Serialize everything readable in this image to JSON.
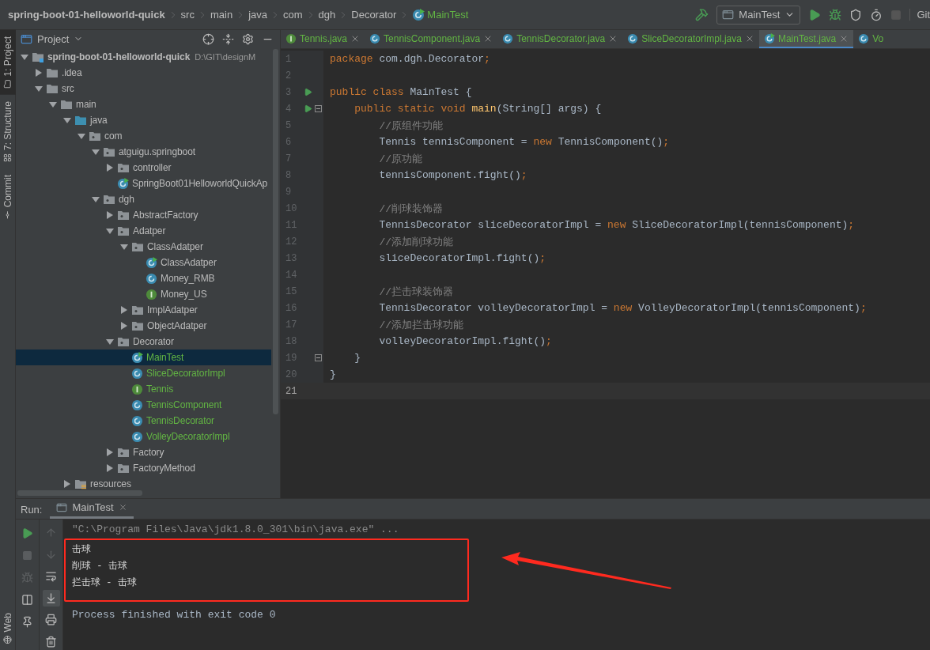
{
  "breadcrumbs": [
    {
      "label": "spring-boot-01-helloworld-quick",
      "kind": "module"
    },
    {
      "label": "src",
      "kind": "folder"
    },
    {
      "label": "main",
      "kind": "folder"
    },
    {
      "label": "java",
      "kind": "folder"
    },
    {
      "label": "com",
      "kind": "folder"
    },
    {
      "label": "dgh",
      "kind": "folder"
    },
    {
      "label": "Decorator",
      "kind": "folder"
    },
    {
      "label": "MainTest",
      "kind": "class"
    }
  ],
  "toolbar": {
    "run_config": "MainTest",
    "vcs_label": "Git"
  },
  "left_stripe": {
    "top": [
      {
        "label": "1: Project",
        "selected": true,
        "kind": "project"
      },
      {
        "label": "7: Structure",
        "selected": false,
        "kind": "structure"
      },
      {
        "label": "Commit",
        "selected": false,
        "kind": "commit"
      }
    ],
    "bottom": [
      {
        "label": "Web",
        "selected": false,
        "kind": "web"
      }
    ]
  },
  "project_panel": {
    "title": "Project",
    "tree": [
      {
        "label": "spring-boot-01-helloworld-quick",
        "path": "D:\\GIT\\designM",
        "kind": "module",
        "expanded": true,
        "selected": false,
        "children": [
          {
            "label": ".idea",
            "kind": "folder",
            "expanded": false,
            "selected": false
          },
          {
            "label": "src",
            "kind": "folder",
            "expanded": true,
            "selected": false,
            "children": [
              {
                "label": "main",
                "kind": "folder",
                "expanded": true,
                "selected": false,
                "children": [
                  {
                    "label": "java",
                    "kind": "source-folder",
                    "expanded": true,
                    "selected": false,
                    "children": [
                      {
                        "label": "com",
                        "kind": "package",
                        "expanded": true,
                        "selected": false,
                        "children": [
                          {
                            "label": "atguigu.springboot",
                            "kind": "package",
                            "expanded": true,
                            "selected": false,
                            "children": [
                              {
                                "label": "controller",
                                "kind": "package",
                                "expanded": false,
                                "selected": false
                              },
                              {
                                "label": "SpringBoot01HelloworldQuickAp",
                                "kind": "class",
                                "runnable": true,
                                "added": false,
                                "selected": false
                              }
                            ]
                          },
                          {
                            "label": "dgh",
                            "kind": "package",
                            "expanded": true,
                            "selected": false,
                            "children": [
                              {
                                "label": "AbstractFactory",
                                "kind": "package",
                                "expanded": false,
                                "selected": false
                              },
                              {
                                "label": "Adatper",
                                "kind": "package",
                                "expanded": true,
                                "selected": false,
                                "children": [
                                  {
                                    "label": "ClassAdatper",
                                    "kind": "package",
                                    "expanded": true,
                                    "selected": false,
                                    "children": [
                                      {
                                        "label": "ClassAdatper",
                                        "kind": "class",
                                        "runnable": true,
                                        "added": false,
                                        "selected": false
                                      },
                                      {
                                        "label": "Money_RMB",
                                        "kind": "class",
                                        "runnable": false,
                                        "added": false,
                                        "selected": false
                                      },
                                      {
                                        "label": "Money_US",
                                        "kind": "interface",
                                        "runnable": false,
                                        "added": false,
                                        "selected": false
                                      }
                                    ]
                                  },
                                  {
                                    "label": "ImplAdatper",
                                    "kind": "package",
                                    "expanded": false,
                                    "selected": false
                                  },
                                  {
                                    "label": "ObjectAdatper",
                                    "kind": "package",
                                    "expanded": false,
                                    "selected": false
                                  }
                                ]
                              },
                              {
                                "label": "Decorator",
                                "kind": "package",
                                "expanded": true,
                                "selected": false,
                                "children": [
                                  {
                                    "label": "MainTest",
                                    "kind": "class",
                                    "runnable": true,
                                    "added": true,
                                    "selected": true
                                  },
                                  {
                                    "label": "SliceDecoratorImpl",
                                    "kind": "class",
                                    "runnable": false,
                                    "added": true,
                                    "selected": false
                                  },
                                  {
                                    "label": "Tennis",
                                    "kind": "interface",
                                    "runnable": false,
                                    "added": true,
                                    "selected": false
                                  },
                                  {
                                    "label": "TennisComponent",
                                    "kind": "class",
                                    "runnable": false,
                                    "added": true,
                                    "selected": false
                                  },
                                  {
                                    "label": "TennisDecorator",
                                    "kind": "class",
                                    "runnable": false,
                                    "added": true,
                                    "selected": false
                                  },
                                  {
                                    "label": "VolleyDecoratorImpl",
                                    "kind": "class",
                                    "runnable": false,
                                    "added": true,
                                    "selected": false
                                  }
                                ]
                              },
                              {
                                "label": "Factory",
                                "kind": "package",
                                "expanded": false,
                                "selected": false
                              },
                              {
                                "label": "FactoryMethod",
                                "kind": "package",
                                "expanded": false,
                                "selected": false
                              }
                            ]
                          }
                        ]
                      }
                    ]
                  },
                  {
                    "label": "resources",
                    "kind": "resource-folder",
                    "expanded": false,
                    "selected": false
                  }
                ]
              }
            ]
          }
        ]
      }
    ]
  },
  "editor": {
    "tabs": [
      {
        "label": "Tennis.java",
        "kind": "interface",
        "runnable": false,
        "selected": false,
        "closable": true
      },
      {
        "label": "TennisComponent.java",
        "kind": "class",
        "runnable": false,
        "selected": false,
        "closable": true
      },
      {
        "label": "TennisDecorator.java",
        "kind": "class",
        "runnable": false,
        "selected": false,
        "closable": true
      },
      {
        "label": "SliceDecoratorImpl.java",
        "kind": "class",
        "runnable": false,
        "selected": false,
        "closable": true
      },
      {
        "label": "MainTest.java",
        "kind": "class",
        "runnable": true,
        "selected": true,
        "closable": true
      },
      {
        "label": "Vo",
        "kind": "class",
        "runnable": false,
        "selected": false,
        "closable": false
      }
    ],
    "lines": [
      {
        "number": "1",
        "run": false,
        "fold": false,
        "current": false,
        "tokens": [
          {
            "text": "package ",
            "kind": "keyword"
          },
          {
            "text": "com.dgh.Decorator",
            "kind": "plain"
          },
          {
            "text": ";",
            "kind": "keyword"
          }
        ]
      },
      {
        "number": "2",
        "run": false,
        "fold": false,
        "current": false
      },
      {
        "number": "3",
        "run": true,
        "fold": false,
        "current": false,
        "tokens": [
          {
            "text": "public class ",
            "kind": "keyword"
          },
          {
            "text": "MainTest {",
            "kind": "plain"
          }
        ]
      },
      {
        "number": "4",
        "run": true,
        "fold": true,
        "current": false,
        "tokens": [
          {
            "text": "    public static void ",
            "kind": "keyword"
          },
          {
            "text": "main",
            "kind": "method"
          },
          {
            "text": "(String[] args) {",
            "kind": "plain"
          }
        ]
      },
      {
        "number": "5",
        "run": false,
        "fold": false,
        "current": false,
        "tokens": [
          {
            "text": "        //原组件功能",
            "kind": "comment"
          }
        ]
      },
      {
        "number": "6",
        "run": false,
        "fold": false,
        "current": false,
        "tokens": [
          {
            "text": "        Tennis tennisComponent = ",
            "kind": "plain"
          },
          {
            "text": "new ",
            "kind": "keyword"
          },
          {
            "text": "TennisComponent()",
            "kind": "plain"
          },
          {
            "text": ";",
            "kind": "keyword"
          }
        ]
      },
      {
        "number": "7",
        "run": false,
        "fold": false,
        "current": false,
        "tokens": [
          {
            "text": "        //原功能",
            "kind": "comment"
          }
        ]
      },
      {
        "number": "8",
        "run": false,
        "fold": false,
        "current": false,
        "tokens": [
          {
            "text": "        tennisComponent.fight()",
            "kind": "plain"
          },
          {
            "text": ";",
            "kind": "keyword"
          }
        ]
      },
      {
        "number": "9",
        "run": false,
        "fold": false,
        "current": false
      },
      {
        "number": "10",
        "run": false,
        "fold": false,
        "current": false,
        "tokens": [
          {
            "text": "        //削球装饰器",
            "kind": "comment"
          }
        ]
      },
      {
        "number": "11",
        "run": false,
        "fold": false,
        "current": false,
        "tokens": [
          {
            "text": "        TennisDecorator sliceDecoratorImpl = ",
            "kind": "plain"
          },
          {
            "text": "new ",
            "kind": "keyword"
          },
          {
            "text": "SliceDecoratorImpl(tennisComponent)",
            "kind": "plain"
          },
          {
            "text": ";",
            "kind": "keyword"
          }
        ]
      },
      {
        "number": "12",
        "run": false,
        "fold": false,
        "current": false,
        "tokens": [
          {
            "text": "        //添加削球功能",
            "kind": "comment"
          }
        ]
      },
      {
        "number": "13",
        "run": false,
        "fold": false,
        "current": false,
        "tokens": [
          {
            "text": "        sliceDecoratorImpl.fight()",
            "kind": "plain"
          },
          {
            "text": ";",
            "kind": "keyword"
          }
        ]
      },
      {
        "number": "14",
        "run": false,
        "fold": false,
        "current": false
      },
      {
        "number": "15",
        "run": false,
        "fold": false,
        "current": false,
        "tokens": [
          {
            "text": "        //拦击球装饰器",
            "kind": "comment"
          }
        ]
      },
      {
        "number": "16",
        "run": false,
        "fold": false,
        "current": false,
        "tokens": [
          {
            "text": "        TennisDecorator volleyDecoratorImpl = ",
            "kind": "plain"
          },
          {
            "text": "new ",
            "kind": "keyword"
          },
          {
            "text": "VolleyDecoratorImpl(tennisComponent)",
            "kind": "plain"
          },
          {
            "text": ";",
            "kind": "keyword"
          }
        ]
      },
      {
        "number": "17",
        "run": false,
        "fold": false,
        "current": false,
        "tokens": [
          {
            "text": "        //添加拦击球功能",
            "kind": "comment"
          }
        ]
      },
      {
        "number": "18",
        "run": false,
        "fold": false,
        "current": false,
        "tokens": [
          {
            "text": "        volleyDecoratorImpl.fight()",
            "kind": "plain"
          },
          {
            "text": ";",
            "kind": "keyword"
          }
        ]
      },
      {
        "number": "19",
        "run": false,
        "fold": true,
        "current": false,
        "tokens": [
          {
            "text": "    }",
            "kind": "plain"
          }
        ]
      },
      {
        "number": "20",
        "run": false,
        "fold": false,
        "current": false,
        "tokens": [
          {
            "text": "}",
            "kind": "plain"
          }
        ]
      },
      {
        "number": "21",
        "run": false,
        "fold": false,
        "current": true
      }
    ]
  },
  "run_panel": {
    "label": "Run:",
    "tabs": [
      {
        "label": "MainTest",
        "selected": true
      }
    ],
    "console": {
      "command": "\"C:\\Program Files\\Java\\jdk1.8.0_301\\bin\\java.exe\" ...",
      "output": [
        "击球",
        "削球 - 击球",
        "拦击球 - 击球"
      ],
      "status": "Process finished with exit code 0"
    }
  }
}
